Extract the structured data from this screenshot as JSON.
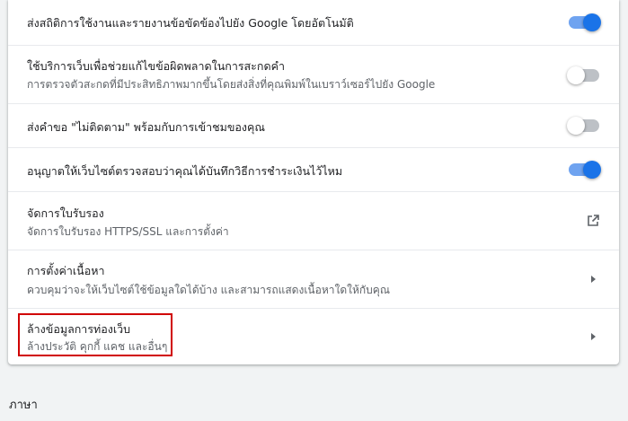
{
  "settings": {
    "row1": {
      "title": "ส่งสถิติการใช้งานและรายงานข้อขัดข้องไปยัง Google โดยอัตโนมัติ",
      "toggle": "on"
    },
    "row2": {
      "title": "ใช้บริการเว็บเพื่อช่วยแก้ไขข้อผิดพลาดในการสะกดคำ",
      "subtitle": "การตรวจตัวสะกดที่มีประสิทธิภาพมากขึ้นโดยส่งสิ่งที่คุณพิมพ์ในเบราว์เซอร์ไปยัง Google",
      "toggle": "off"
    },
    "row3": {
      "title": "ส่งคำขอ \"ไม่ติดตาม\" พร้อมกับการเข้าชมของคุณ",
      "toggle": "off"
    },
    "row4": {
      "title": "อนุญาตให้เว็บไซต์ตรวจสอบว่าคุณได้บันทึกวิธีการชำระเงินไว้ไหม",
      "toggle": "on"
    },
    "row5": {
      "title": "จัดการใบรับรอง",
      "subtitle": "จัดการใบรับรอง HTTPS/SSL และการตั้งค่า",
      "icon": "open-in-new-icon"
    },
    "row6": {
      "title": "การตั้งค่าเนื้อหา",
      "subtitle": "ควบคุมว่าจะให้เว็บไซต์ใช้ข้อมูลใดได้บ้าง และสามารถแสดงเนื้อหาใดให้กับคุณ",
      "icon": "arrow-right-icon"
    },
    "row7": {
      "title": "ล้างข้อมูลการท่องเว็บ",
      "subtitle": "ล้างประวัติ คุกกี้ แคช และอื่นๆ",
      "icon": "arrow-right-icon"
    }
  },
  "section_heading": "ภาษา",
  "colors": {
    "toggle_on": "#1a73e8",
    "highlight": "#d00000"
  }
}
